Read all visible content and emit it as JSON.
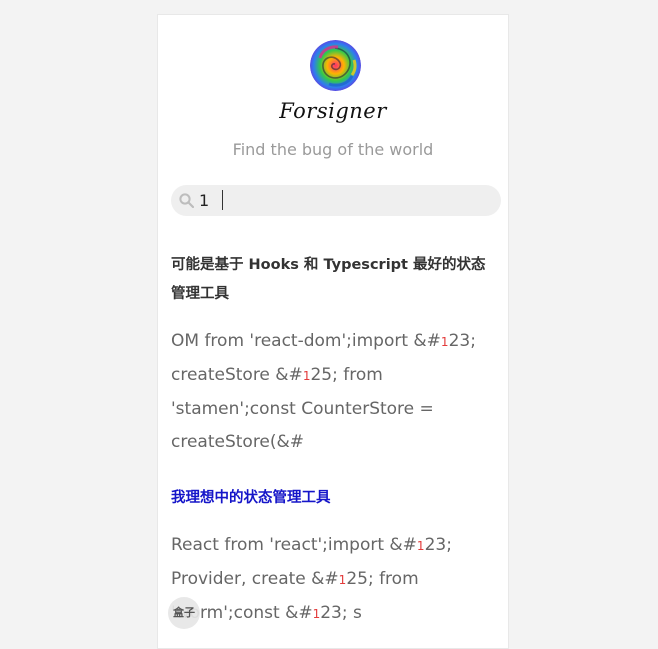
{
  "profile": {
    "brand_name": "Forsigner",
    "tagline": "Find the bug of the world",
    "avatar_icon": "rose-avatar-icon"
  },
  "search": {
    "value": "1",
    "icon": "search-icon"
  },
  "results": [
    {
      "title": "可能是基于 Hooks 和 Typescript 最好的状态管理工具",
      "excerpt_parts": [
        "OM from 'react-dom';import &#",
        "1",
        "23; createStore &#",
        "1",
        "25; from 'stamen';const CounterStore = createStore(&#"
      ]
    },
    {
      "title": "我理想中的状态管理工具",
      "excerpt_parts": [
        "React from 'react';import &#",
        "1",
        "23; Provider, create &#",
        "1",
        "25; from '",
        "worm';const &#",
        "1",
        "23; s"
      ]
    }
  ],
  "floating_button": {
    "label": "盒子"
  },
  "colors": {
    "link": "#1515c9",
    "highlight": "#e33b3b",
    "muted": "#9a9a9a"
  }
}
